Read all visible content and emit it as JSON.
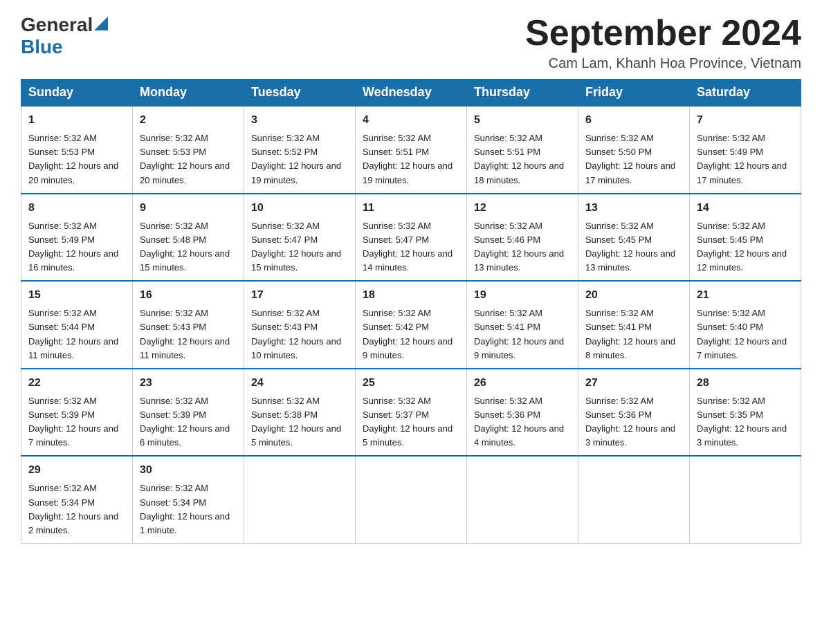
{
  "logo": {
    "general": "General",
    "blue": "Blue"
  },
  "title": "September 2024",
  "location": "Cam Lam, Khanh Hoa Province, Vietnam",
  "weekdays": [
    "Sunday",
    "Monday",
    "Tuesday",
    "Wednesday",
    "Thursday",
    "Friday",
    "Saturday"
  ],
  "weeks": [
    [
      {
        "day": "1",
        "sunrise": "5:32 AM",
        "sunset": "5:53 PM",
        "daylight": "12 hours and 20 minutes."
      },
      {
        "day": "2",
        "sunrise": "5:32 AM",
        "sunset": "5:53 PM",
        "daylight": "12 hours and 20 minutes."
      },
      {
        "day": "3",
        "sunrise": "5:32 AM",
        "sunset": "5:52 PM",
        "daylight": "12 hours and 19 minutes."
      },
      {
        "day": "4",
        "sunrise": "5:32 AM",
        "sunset": "5:51 PM",
        "daylight": "12 hours and 19 minutes."
      },
      {
        "day": "5",
        "sunrise": "5:32 AM",
        "sunset": "5:51 PM",
        "daylight": "12 hours and 18 minutes."
      },
      {
        "day": "6",
        "sunrise": "5:32 AM",
        "sunset": "5:50 PM",
        "daylight": "12 hours and 17 minutes."
      },
      {
        "day": "7",
        "sunrise": "5:32 AM",
        "sunset": "5:49 PM",
        "daylight": "12 hours and 17 minutes."
      }
    ],
    [
      {
        "day": "8",
        "sunrise": "5:32 AM",
        "sunset": "5:49 PM",
        "daylight": "12 hours and 16 minutes."
      },
      {
        "day": "9",
        "sunrise": "5:32 AM",
        "sunset": "5:48 PM",
        "daylight": "12 hours and 15 minutes."
      },
      {
        "day": "10",
        "sunrise": "5:32 AM",
        "sunset": "5:47 PM",
        "daylight": "12 hours and 15 minutes."
      },
      {
        "day": "11",
        "sunrise": "5:32 AM",
        "sunset": "5:47 PM",
        "daylight": "12 hours and 14 minutes."
      },
      {
        "day": "12",
        "sunrise": "5:32 AM",
        "sunset": "5:46 PM",
        "daylight": "12 hours and 13 minutes."
      },
      {
        "day": "13",
        "sunrise": "5:32 AM",
        "sunset": "5:45 PM",
        "daylight": "12 hours and 13 minutes."
      },
      {
        "day": "14",
        "sunrise": "5:32 AM",
        "sunset": "5:45 PM",
        "daylight": "12 hours and 12 minutes."
      }
    ],
    [
      {
        "day": "15",
        "sunrise": "5:32 AM",
        "sunset": "5:44 PM",
        "daylight": "12 hours and 11 minutes."
      },
      {
        "day": "16",
        "sunrise": "5:32 AM",
        "sunset": "5:43 PM",
        "daylight": "12 hours and 11 minutes."
      },
      {
        "day": "17",
        "sunrise": "5:32 AM",
        "sunset": "5:43 PM",
        "daylight": "12 hours and 10 minutes."
      },
      {
        "day": "18",
        "sunrise": "5:32 AM",
        "sunset": "5:42 PM",
        "daylight": "12 hours and 9 minutes."
      },
      {
        "day": "19",
        "sunrise": "5:32 AM",
        "sunset": "5:41 PM",
        "daylight": "12 hours and 9 minutes."
      },
      {
        "day": "20",
        "sunrise": "5:32 AM",
        "sunset": "5:41 PM",
        "daylight": "12 hours and 8 minutes."
      },
      {
        "day": "21",
        "sunrise": "5:32 AM",
        "sunset": "5:40 PM",
        "daylight": "12 hours and 7 minutes."
      }
    ],
    [
      {
        "day": "22",
        "sunrise": "5:32 AM",
        "sunset": "5:39 PM",
        "daylight": "12 hours and 7 minutes."
      },
      {
        "day": "23",
        "sunrise": "5:32 AM",
        "sunset": "5:39 PM",
        "daylight": "12 hours and 6 minutes."
      },
      {
        "day": "24",
        "sunrise": "5:32 AM",
        "sunset": "5:38 PM",
        "daylight": "12 hours and 5 minutes."
      },
      {
        "day": "25",
        "sunrise": "5:32 AM",
        "sunset": "5:37 PM",
        "daylight": "12 hours and 5 minutes."
      },
      {
        "day": "26",
        "sunrise": "5:32 AM",
        "sunset": "5:36 PM",
        "daylight": "12 hours and 4 minutes."
      },
      {
        "day": "27",
        "sunrise": "5:32 AM",
        "sunset": "5:36 PM",
        "daylight": "12 hours and 3 minutes."
      },
      {
        "day": "28",
        "sunrise": "5:32 AM",
        "sunset": "5:35 PM",
        "daylight": "12 hours and 3 minutes."
      }
    ],
    [
      {
        "day": "29",
        "sunrise": "5:32 AM",
        "sunset": "5:34 PM",
        "daylight": "12 hours and 2 minutes."
      },
      {
        "day": "30",
        "sunrise": "5:32 AM",
        "sunset": "5:34 PM",
        "daylight": "12 hours and 1 minute."
      },
      null,
      null,
      null,
      null,
      null
    ]
  ],
  "labels": {
    "sunrise": "Sunrise:",
    "sunset": "Sunset:",
    "daylight": "Daylight:"
  }
}
